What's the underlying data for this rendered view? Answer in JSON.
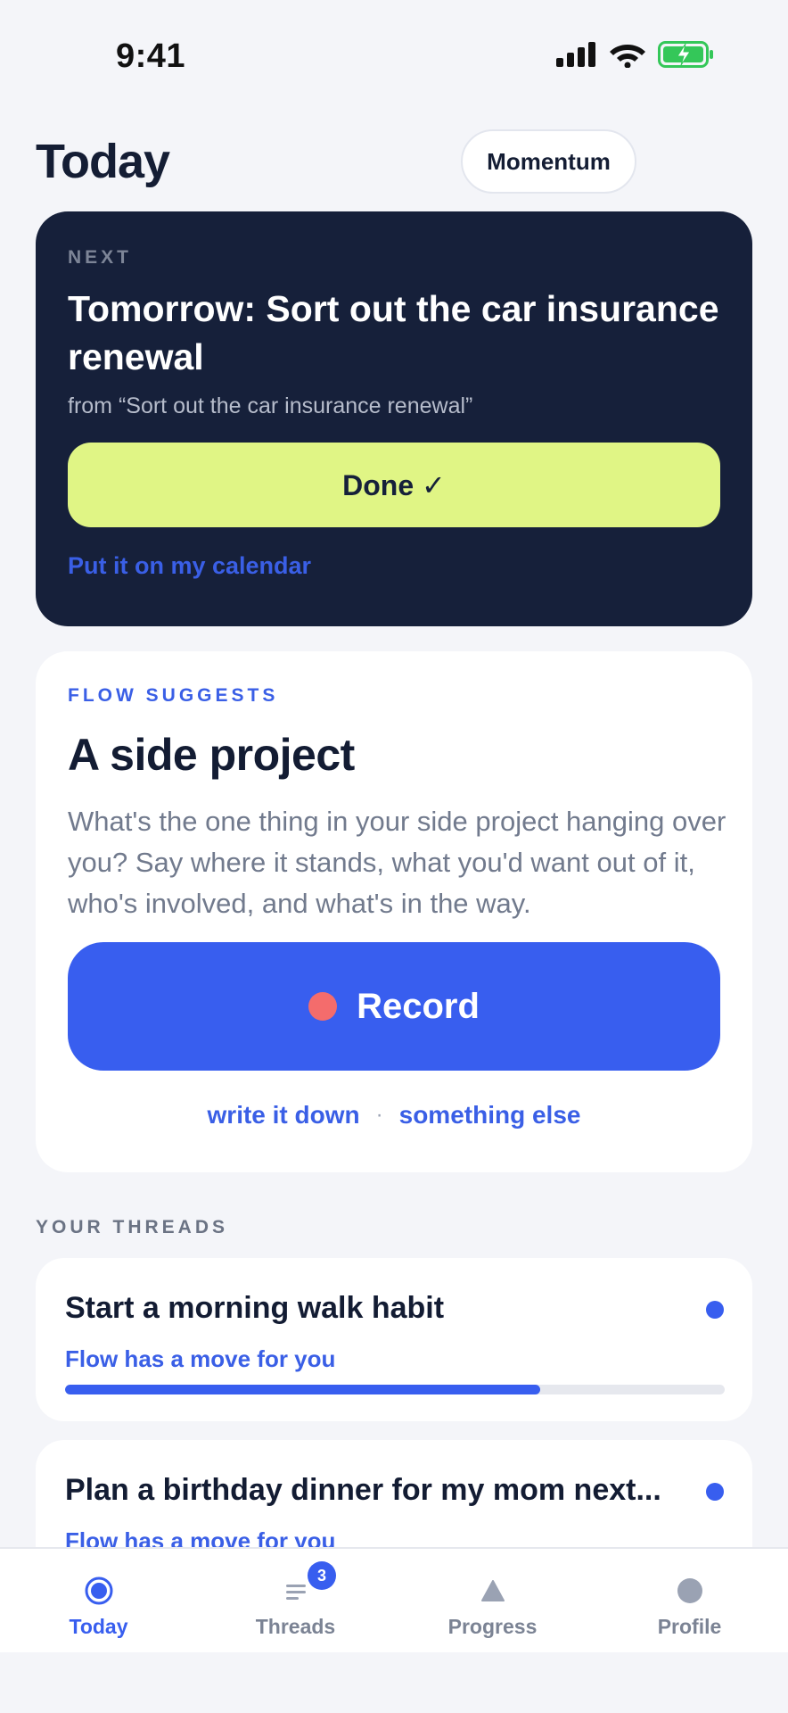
{
  "status_bar": {
    "time": "9:41",
    "icons": [
      "cellular-signal-icon",
      "wifi-icon",
      "battery-charging-icon"
    ],
    "battery_color": "#34c759"
  },
  "header": {
    "title": "Today",
    "momentum_label": "Momentum"
  },
  "next_card": {
    "eyebrow": "NEXT",
    "title": "Tomorrow: Sort out the car insurance renewal",
    "from": "from “Sort out the car insurance renewal”",
    "done_label": "Done ✓",
    "calendar_link": "Put it on my calendar"
  },
  "suggest_card": {
    "eyebrow": "FLOW SUGGESTS",
    "title": "A side project",
    "description": "What's the one thing in your side project hanging over you? Say where it stands, what you'd want out of it, who's involved, and what's in the way.",
    "record_label": "Record",
    "write_link": "write it down",
    "separator": "·",
    "else_link": "something else"
  },
  "threads": {
    "heading": "YOUR THREADS",
    "items": [
      {
        "title": "Start a morning walk habit",
        "status": "Flow has a move for you",
        "progress": 0.72
      },
      {
        "title": "Plan a birthday dinner for my mom next...",
        "status": "Flow has a move for you"
      }
    ]
  },
  "tab_bar": {
    "tabs": [
      {
        "label": "Today",
        "icon": "today-icon",
        "active": true
      },
      {
        "label": "Threads",
        "icon": "threads-icon",
        "badge": "3"
      },
      {
        "label": "Progress",
        "icon": "progress-icon"
      },
      {
        "label": "Profile",
        "icon": "profile-icon"
      }
    ]
  },
  "colors": {
    "accent": "#385eef",
    "dark_card": "#16203a",
    "done_button": "#e0f585",
    "record_dot": "#f46c6c"
  }
}
